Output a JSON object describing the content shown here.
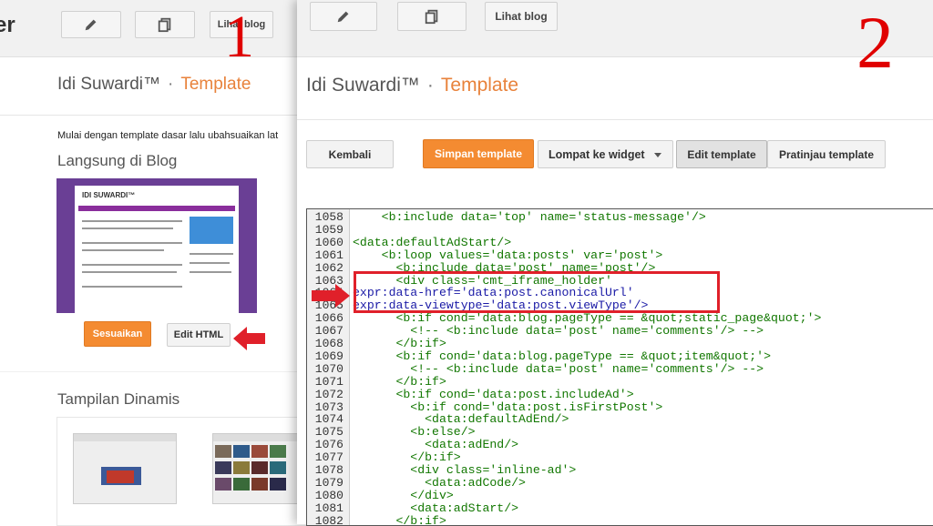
{
  "left_window": {
    "app_name": "er",
    "toolbar": {
      "view_blog_label": "Lihat blog"
    },
    "step_number": "1",
    "blog_name": "Idi Suwardi™",
    "separator": "·",
    "page_title": "Template",
    "intro_text": "Mulai dengan template dasar lalu ubahsuaikan lat",
    "live_section_title": "Langsung di Blog",
    "thumbnail_title": "IDI SUWARDI™",
    "customize_label": "Sesuaikan",
    "edit_html_label": "Edit HTML",
    "dynamic_section_title": "Tampilan Dinamis"
  },
  "right_window": {
    "toolbar": {
      "view_blog_label": "Lihat blog"
    },
    "step_number": "2",
    "blog_name": "Idi Suwardi™",
    "separator": "·",
    "page_title": "Template",
    "buttons": {
      "back": "Kembali",
      "save": "Simpan template",
      "jump": "Lompat ke widget",
      "edit": "Edit template",
      "preview": "Pratinjau template"
    },
    "code_lines": [
      {
        "n": "1058",
        "text": "    <b:include data='top' name='status-message'/>"
      },
      {
        "n": "1059",
        "text": ""
      },
      {
        "n": "1060",
        "text": "<data:defaultAdStart/>"
      },
      {
        "n": "1061",
        "text": "    <b:loop values='data:posts' var='post'>"
      },
      {
        "n": "1062",
        "text": "      <b:include data='post' name='post'/>"
      },
      {
        "n": "1063",
        "text": "      <div class='cmt_iframe_holder'"
      },
      {
        "n": "1064",
        "text": "expr:data-href='data:post.canonicalUrl'"
      },
      {
        "n": "1065",
        "text": "expr:data-viewtype='data:post.viewType'/>"
      },
      {
        "n": "1066",
        "text": "      <b:if cond='data:blog.pageType == &quot;static_page&quot;'>"
      },
      {
        "n": "1067",
        "text": "        <!-- <b:include data='post' name='comments'/> -->"
      },
      {
        "n": "1068",
        "text": "      </b:if>"
      },
      {
        "n": "1069",
        "text": "      <b:if cond='data:blog.pageType == &quot;item&quot;'>"
      },
      {
        "n": "1070",
        "text": "        <!-- <b:include data='post' name='comments'/> -->"
      },
      {
        "n": "1071",
        "text": "      </b:if>"
      },
      {
        "n": "1072",
        "text": "      <b:if cond='data:post.includeAd'>"
      },
      {
        "n": "1073",
        "text": "        <b:if cond='data:post.isFirstPost'>"
      },
      {
        "n": "1074",
        "text": "          <data:defaultAdEnd/>"
      },
      {
        "n": "1075",
        "text": "        <b:else/>"
      },
      {
        "n": "1076",
        "text": "          <data:adEnd/>"
      },
      {
        "n": "1077",
        "text": "        </b:if>"
      },
      {
        "n": "1078",
        "text": "        <div class='inline-ad'>"
      },
      {
        "n": "1079",
        "text": "          <data:adCode/>"
      },
      {
        "n": "1080",
        "text": "        </div>"
      },
      {
        "n": "1081",
        "text": "        <data:adStart/>"
      },
      {
        "n": "1082",
        "text": "      </b:if>"
      }
    ]
  },
  "colors": {
    "accent_orange": "#f48b31",
    "annotation_red": "#e0202a",
    "code_green": "#117700",
    "code_blue": "#1a1aa6"
  }
}
